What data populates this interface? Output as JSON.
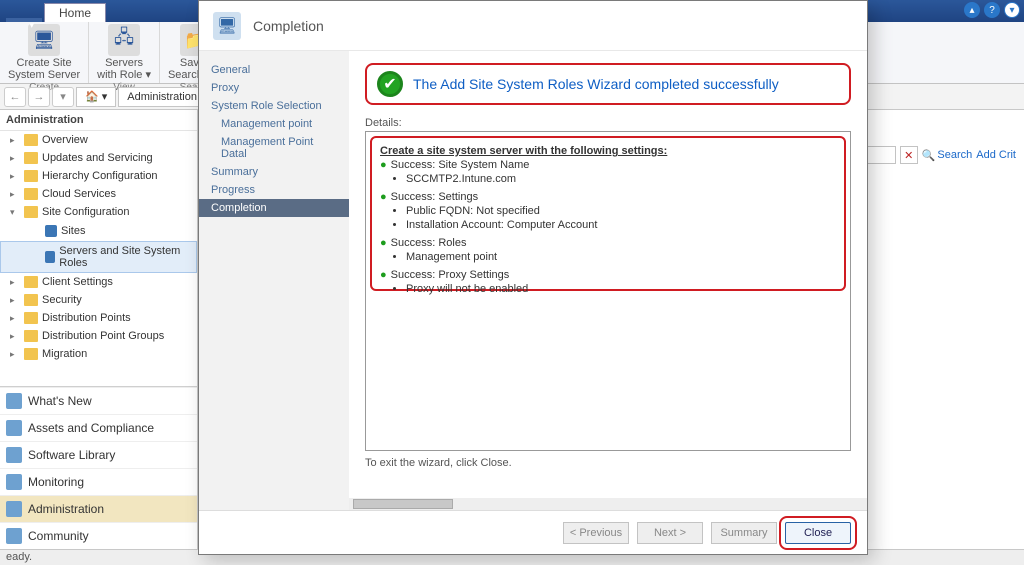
{
  "tabs": {
    "file": "▾",
    "home": "Home"
  },
  "ribbon": {
    "create": {
      "l1": "Create Site",
      "l2": "System Server",
      "cap": "Create"
    },
    "view": {
      "l1": "Servers",
      "l2": "with Role ▾",
      "cap": "View"
    },
    "search": {
      "l1": "Saved",
      "l2": "Searches ▾",
      "cap": "Search"
    }
  },
  "breadcrumb": {
    "root": "Administration",
    "caret": "▸"
  },
  "nav": {
    "header": "Administration",
    "items": [
      {
        "label": "Overview"
      },
      {
        "label": "Updates and Servicing"
      },
      {
        "label": "Hierarchy Configuration"
      },
      {
        "label": "Cloud Services"
      },
      {
        "label": "Site Configuration",
        "open": true,
        "children": [
          {
            "label": "Sites"
          },
          {
            "label": "Servers and Site System Roles",
            "sel": true
          }
        ]
      },
      {
        "label": "Client Settings"
      },
      {
        "label": "Security"
      },
      {
        "label": "Distribution Points"
      },
      {
        "label": "Distribution Point Groups"
      },
      {
        "label": "Migration"
      }
    ]
  },
  "wunderbar": [
    {
      "label": "What's New"
    },
    {
      "label": "Assets and Compliance"
    },
    {
      "label": "Software Library"
    },
    {
      "label": "Monitoring"
    },
    {
      "label": "Administration",
      "active": true
    },
    {
      "label": "Community"
    }
  ],
  "search": {
    "placeholder": "",
    "search_label": "Search",
    "addcrit": "Add Crit"
  },
  "status": "eady.",
  "modal": {
    "title": "Completion",
    "steps": [
      "General",
      "Proxy",
      "System Role Selection",
      "Management point",
      "Management Point Datal",
      "Summary",
      "Progress",
      "Completion"
    ],
    "steps_sub": [
      3,
      4
    ],
    "active_step": 7,
    "success": "The Add Site System Roles Wizard completed successfully",
    "details_label": "Details:",
    "details": {
      "heading": "Create a site system server with the following settings:",
      "groups": [
        {
          "title": "Success: Site System Name",
          "items": [
            "SCCMTP2.Intune.com"
          ]
        },
        {
          "title": "Success: Settings",
          "items": [
            "Public FQDN: Not specified",
            "Installation Account: Computer Account"
          ]
        },
        {
          "title": "Success: Roles",
          "items": [
            "Management point"
          ]
        },
        {
          "title": "Success: Proxy Settings",
          "items": [
            "Proxy will not be enabled"
          ]
        }
      ]
    },
    "exit_hint": "To exit the wizard, click Close.",
    "buttons": {
      "prev": "< Previous",
      "next": "Next >",
      "summary": "Summary",
      "close": "Close"
    }
  }
}
